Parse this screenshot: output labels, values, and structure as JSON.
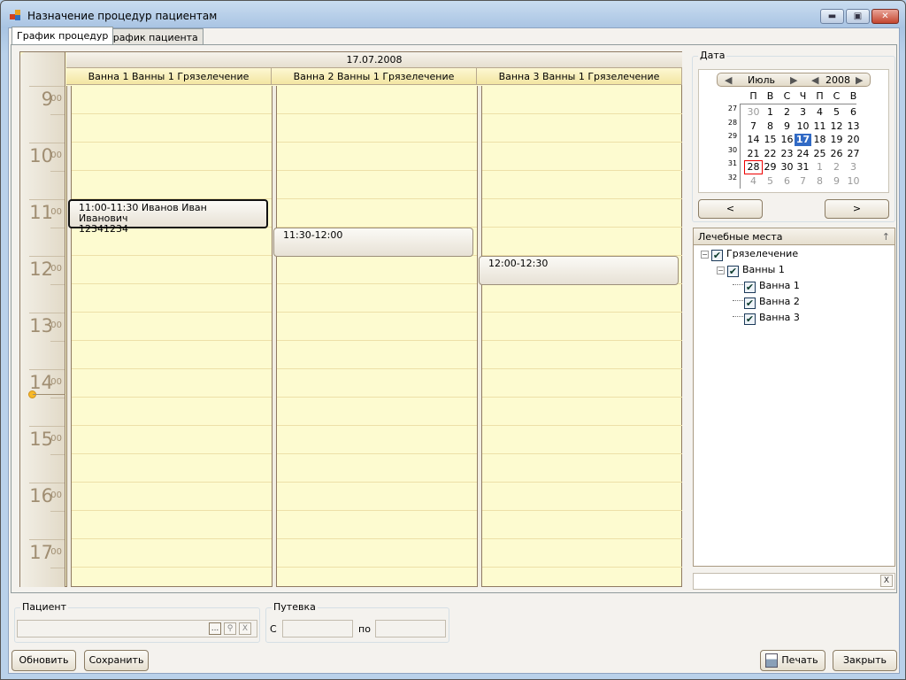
{
  "window": {
    "title": "Назначение процедур пациентам",
    "minimize": "▬",
    "maximize": "▣",
    "close": "✕"
  },
  "tabs": [
    {
      "label": "График процедур",
      "active": true
    },
    {
      "label": "График пациента",
      "active": false
    }
  ],
  "schedule": {
    "date": "17.07.2008",
    "columns": [
      "Ванна 1 Ванны 1 Грязелечение",
      "Ванна 2 Ванны 1 Грязелечение",
      "Ванна 3 Ванны 1 Грязелечение"
    ],
    "hours": [
      "9",
      "10",
      "11",
      "12",
      "13",
      "14",
      "15",
      "16",
      "17"
    ],
    "minutes": "00",
    "current_time_hour": 14,
    "appointments": [
      {
        "column": 0,
        "start": 11.0,
        "end": 11.5,
        "line1": "11:00-11:30 Иванов Иван Иванович",
        "line2": "12341234",
        "selected": true
      },
      {
        "column": 1,
        "start": 11.5,
        "end": 12.0,
        "line1": "11:30-12:00",
        "line2": "",
        "selected": false
      },
      {
        "column": 2,
        "start": 12.0,
        "end": 12.5,
        "line1": "12:00-12:30",
        "line2": "",
        "selected": false
      }
    ]
  },
  "date_group": {
    "label": "Дата",
    "month": "Июль",
    "year": "2008",
    "prev": "<",
    "next": ">",
    "dow": [
      "П",
      "В",
      "С",
      "Ч",
      "П",
      "С",
      "В"
    ],
    "weeks": [
      {
        "n": "27",
        "days": [
          "30",
          "1",
          "2",
          "3",
          "4",
          "5",
          "6"
        ],
        "other": [
          0
        ]
      },
      {
        "n": "28",
        "days": [
          "7",
          "8",
          "9",
          "10",
          "11",
          "12",
          "13"
        ],
        "other": []
      },
      {
        "n": "29",
        "days": [
          "14",
          "15",
          "16",
          "17",
          "18",
          "19",
          "20"
        ],
        "other": []
      },
      {
        "n": "30",
        "days": [
          "21",
          "22",
          "23",
          "24",
          "25",
          "26",
          "27"
        ],
        "other": []
      },
      {
        "n": "31",
        "days": [
          "28",
          "29",
          "30",
          "31",
          "1",
          "2",
          "3"
        ],
        "other": [
          4,
          5,
          6
        ]
      },
      {
        "n": "32",
        "days": [
          "4",
          "5",
          "6",
          "7",
          "8",
          "9",
          "10"
        ],
        "other": [
          0,
          1,
          2,
          3,
          4,
          5,
          6
        ]
      }
    ],
    "selected": "17",
    "today": "28"
  },
  "tree": {
    "header": "Лечебные места",
    "collapse_icon": "↑",
    "nodes": [
      {
        "label": "Грязелечение",
        "level": 0,
        "checked": true,
        "expander": "−"
      },
      {
        "label": "Ванны 1",
        "level": 1,
        "checked": true,
        "expander": "−"
      },
      {
        "label": "Ванна 1",
        "level": 2,
        "checked": true
      },
      {
        "label": "Ванна 2",
        "level": 2,
        "checked": true
      },
      {
        "label": "Ванна 3",
        "level": 2,
        "checked": true
      }
    ]
  },
  "filter": {
    "value": "",
    "clear": "X"
  },
  "patient": {
    "label": "Пациент",
    "value": "",
    "browse": "...",
    "search": "⚲",
    "clear": "X"
  },
  "voucher": {
    "label": "Путевка",
    "from_label": "С",
    "to_label": "по",
    "from": "",
    "to": ""
  },
  "buttons": {
    "refresh": "Обновить",
    "save": "Сохранить",
    "print": "Печать",
    "close": "Закрыть"
  }
}
